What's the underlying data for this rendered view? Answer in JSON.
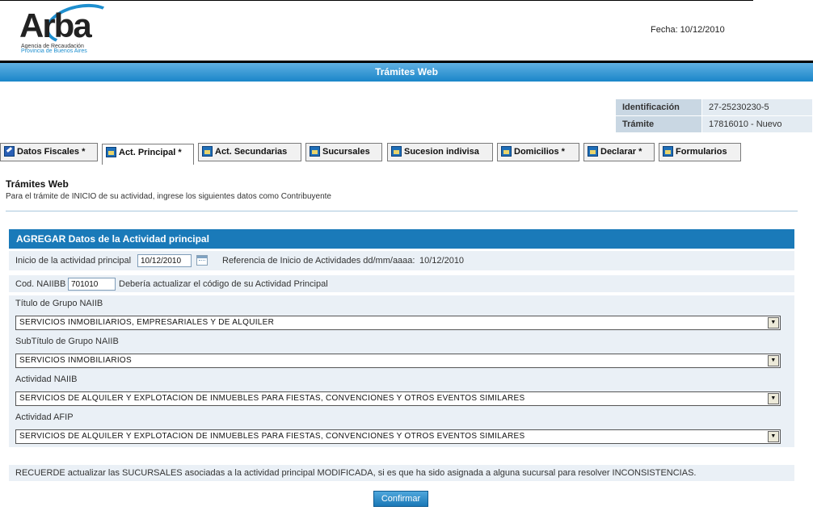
{
  "header": {
    "logo_text": "Arba",
    "logo_sub1": "Agencia de Recaudación",
    "logo_sub2": "Provincia de Buenos Aires",
    "date_label": "Fecha: 10/12/2010"
  },
  "band": {
    "title": "Trámites Web"
  },
  "info": {
    "rows": [
      {
        "key": "Identificación",
        "value": "27-25230230-5"
      },
      {
        "key": "Trámite",
        "value": "17816010 - Nuevo"
      }
    ]
  },
  "tabs": [
    {
      "label": "Datos Fiscales *",
      "icon": "edit-icon",
      "active": false
    },
    {
      "label": "Act. Principal *",
      "icon": "folder-icon",
      "active": true
    },
    {
      "label": "Act. Secundarias",
      "icon": "folder-icon",
      "active": false
    },
    {
      "label": "Sucursales",
      "icon": "folder-icon",
      "active": false
    },
    {
      "label": "Sucesion indivisa",
      "icon": "folder-icon",
      "active": false
    },
    {
      "label": "Domicilios *",
      "icon": "folder-icon",
      "active": false
    },
    {
      "label": "Declarar *",
      "icon": "folder-icon",
      "active": false
    },
    {
      "label": "Formularios",
      "icon": "folder-icon",
      "active": false
    }
  ],
  "page": {
    "title": "Trámites Web",
    "subtitle": "Para el trámite de INICIO de su actividad, ingrese los siguientes datos como Contribuyente"
  },
  "form": {
    "header": "AGREGAR Datos de la Actividad principal",
    "inicio_label": "Inicio de la actividad principal",
    "inicio_value": "10/12/2010",
    "referencia": "Referencia de Inicio de Actividades dd/mm/aaaa:",
    "referencia_value": "10/12/2010",
    "cod_label": "Cod. NAIIBB",
    "cod_value": "701010",
    "cod_hint": "Debería actualizar el código de su Actividad Principal",
    "grupo_label": "Título de Grupo NAIIB",
    "grupo_value": "SERVICIOS INMOBILIARIOS, EMPRESARIALES Y DE ALQUILER",
    "subgrupo_label": "SubTítulo de Grupo NAIIB",
    "subgrupo_value": "SERVICIOS INMOBILIARIOS",
    "actividad_label": "Actividad NAIIB",
    "actividad_value": "SERVICIOS DE ALQUILER Y EXPLOTACION DE INMUEBLES PARA FIESTAS, CONVENCIONES Y OTROS EVENTOS SIMILARES",
    "afip_label": "Actividad AFIP",
    "afip_value": "SERVICIOS DE ALQUILER Y EXPLOTACION DE INMUEBLES PARA FIESTAS, CONVENCIONES Y OTROS EVENTOS SIMILARES"
  },
  "note": "RECUERDE actualizar las SUCURSALES asociadas a la actividad principal MODIFICADA, si es que ha sido asignada a alguna sucursal para resolver INCONSISTENCIAS.",
  "confirm_label": "Confirmar",
  "colors": {
    "brand_blue": "#1a7ab9",
    "row_bg": "#eaf0f6"
  }
}
